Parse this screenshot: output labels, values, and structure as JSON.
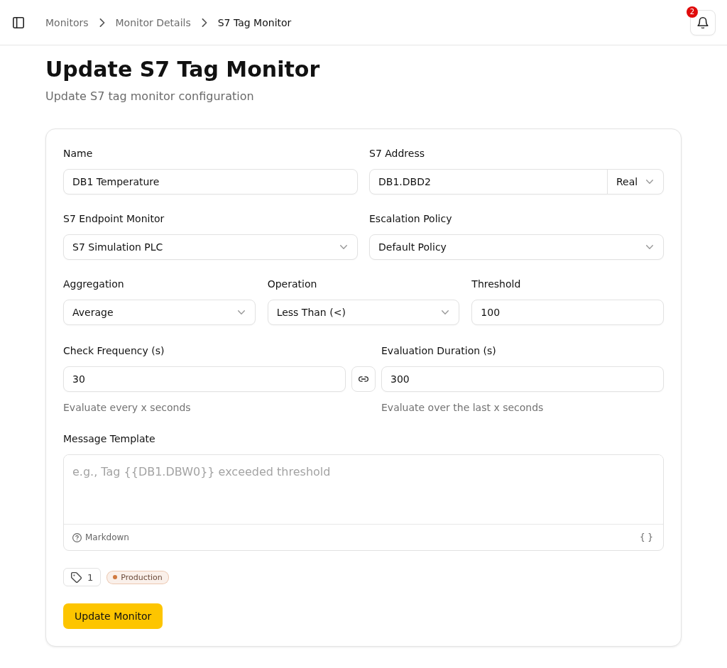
{
  "header": {
    "breadcrumbs": [
      {
        "label": "Monitors",
        "current": false
      },
      {
        "label": "Monitor Details",
        "current": false
      },
      {
        "label": "S7 Tag Monitor",
        "current": true
      }
    ],
    "notifications": {
      "count": "2"
    }
  },
  "page": {
    "title": "Update S7 Tag Monitor",
    "subtitle": "Update S7 tag monitor configuration"
  },
  "form": {
    "rows": [
      [
        {
          "kind": "text",
          "label": "Name",
          "value": "DB1 Temperature"
        },
        {
          "kind": "address",
          "label": "S7 Address",
          "value": "DB1.DBD2",
          "data_type": "Real"
        }
      ],
      [
        {
          "kind": "select",
          "label": "S7 Endpoint Monitor",
          "value": "S7 Simulation PLC"
        },
        {
          "kind": "select",
          "label": "Escalation Policy",
          "value": "Default Policy"
        }
      ],
      [
        {
          "kind": "select",
          "label": "Aggregation",
          "value": "Average"
        },
        {
          "kind": "select",
          "label": "Operation",
          "value": "Less Than (<)"
        },
        {
          "kind": "text",
          "label": "Threshold",
          "value": "100"
        }
      ]
    ],
    "timing": {
      "check_frequency": {
        "label": "Check Frequency (s)",
        "value": "30",
        "hint": "Evaluate every x seconds"
      },
      "evaluation_duration": {
        "label": "Evaluation Duration (s)",
        "value": "300",
        "hint": "Evaluate over the last x seconds"
      }
    },
    "message_template": {
      "label": "Message Template",
      "placeholder": "e.g., Tag {{DB1.DBW0}} exceeded threshold",
      "format": "Markdown",
      "variables_button": "{ }"
    },
    "tags": {
      "count": "1",
      "items": [
        {
          "label": "Production",
          "color": "#d0793f"
        }
      ]
    },
    "submit": "Update Monitor"
  }
}
